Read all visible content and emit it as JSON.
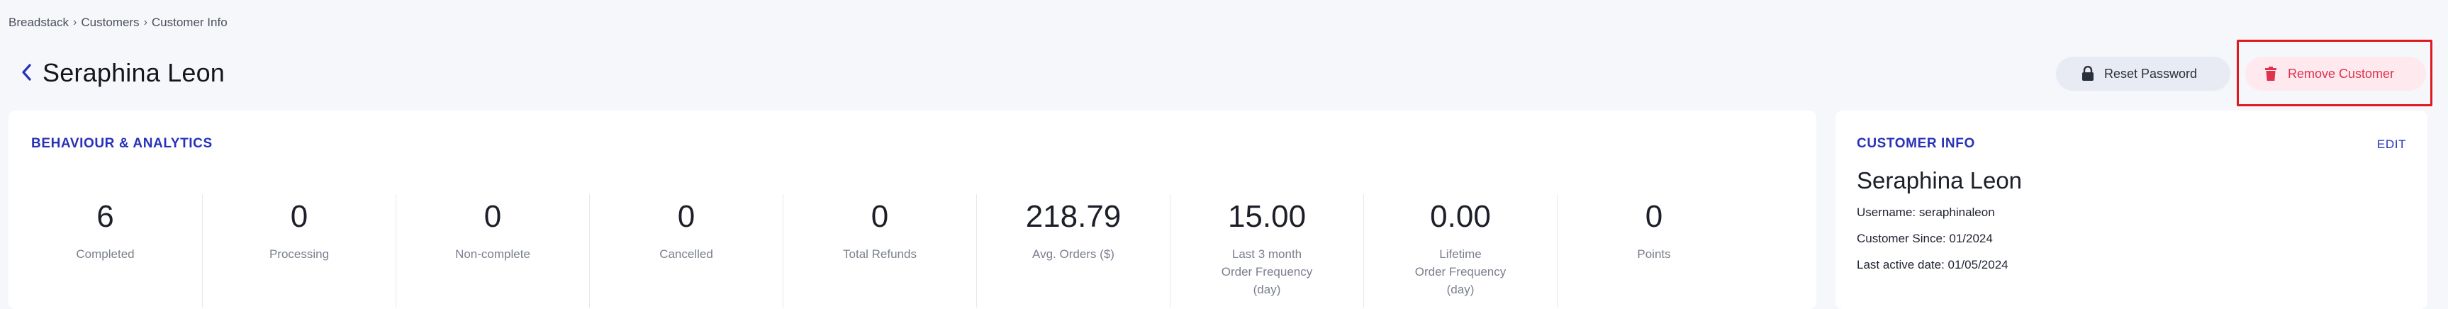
{
  "breadcrumb": [
    "Breadstack",
    "Customers",
    "Customer Info"
  ],
  "header": {
    "title": "Seraphina Leon",
    "reset_password_label": "Reset Password",
    "remove_customer_label": "Remove Customer"
  },
  "analytics": {
    "title": "BEHAVIOUR & ANALYTICS",
    "stats": [
      {
        "value": "6",
        "label": "Completed"
      },
      {
        "value": "0",
        "label": "Processing"
      },
      {
        "value": "0",
        "label": "Non-complete"
      },
      {
        "value": "0",
        "label": "Cancelled"
      },
      {
        "value": "0",
        "label": "Total Refunds"
      },
      {
        "value": "218.79",
        "label": "Avg. Orders ($)"
      },
      {
        "value": "15.00",
        "label": "Last 3 month\nOrder Frequency\n(day)"
      },
      {
        "value": "0.00",
        "label": "Lifetime\nOrder Frequency\n(day)"
      },
      {
        "value": "0",
        "label": "Points"
      }
    ]
  },
  "customer_info": {
    "title": "CUSTOMER INFO",
    "edit_label": "EDIT",
    "name": "Seraphina Leon",
    "username": "Username: seraphinaleon",
    "customer_since": "Customer Since: 01/2024",
    "last_active": "Last active date: 01/05/2024"
  },
  "colors": {
    "accent": "#2732b8",
    "danger": "#e0314f",
    "highlight_frame": "#e0191f"
  }
}
